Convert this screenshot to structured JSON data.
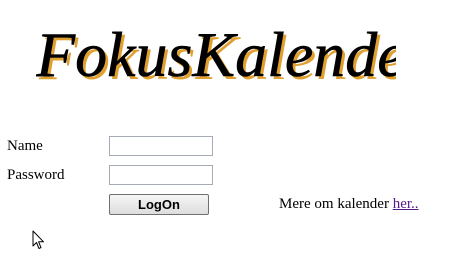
{
  "logo": {
    "text": "FokusKalender"
  },
  "login_form": {
    "name_label": "Name",
    "name_value": "",
    "password_label": "Password",
    "password_value": "",
    "logon_button_label": "LogOn"
  },
  "more_info": {
    "text": "Mere om kalender ",
    "link_text": "her.."
  },
  "colors": {
    "link": "#551a8b",
    "logo_fill": "#000000",
    "logo_shadow": "#e0a030"
  },
  "icons": {
    "cursor": "mouse-pointer-icon"
  }
}
